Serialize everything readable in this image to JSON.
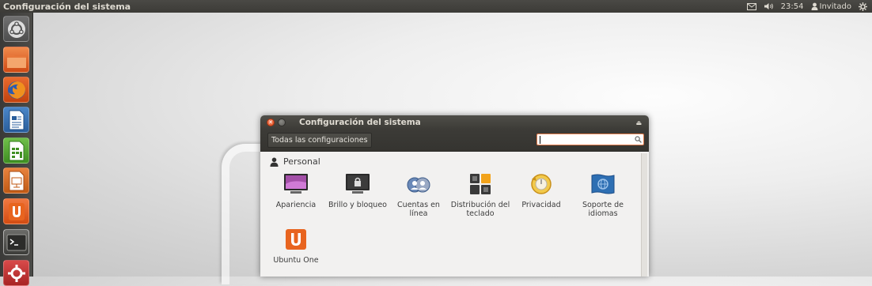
{
  "top_panel": {
    "title": "Configuración del sistema",
    "time": "23:54",
    "user": "Invitado",
    "icons": [
      "mail-icon",
      "volume-icon",
      "user-icon",
      "power-gear-icon"
    ]
  },
  "launcher": {
    "items": [
      {
        "name": "dash-home",
        "icon": "ubuntu-logo-icon"
      },
      {
        "name": "files",
        "icon": "folder-icon"
      },
      {
        "name": "firefox",
        "icon": "firefox-icon"
      },
      {
        "name": "writer",
        "icon": "libreoffice-writer-icon"
      },
      {
        "name": "calc",
        "icon": "libreoffice-calc-icon"
      },
      {
        "name": "impress",
        "icon": "libreoffice-impress-icon"
      },
      {
        "name": "ubuntu-one",
        "icon": "ubuntu-one-icon"
      },
      {
        "name": "terminal",
        "icon": "terminal-icon"
      },
      {
        "name": "system-settings",
        "icon": "settings-icon"
      }
    ]
  },
  "window": {
    "title": "Configuración del sistema",
    "all_settings_label": "Todas las configuraciones",
    "search": {
      "value": "",
      "placeholder": ""
    },
    "section_title": "Personal",
    "items": [
      {
        "label": "Apariencia",
        "icon": "appearance-icon"
      },
      {
        "label": "Brillo y bloqueo",
        "icon": "brightness-lock-icon"
      },
      {
        "label": "Cuentas en línea",
        "icon": "online-accounts-icon"
      },
      {
        "label": "Distribución del teclado",
        "icon": "keyboard-layout-icon"
      },
      {
        "label": "Privacidad",
        "icon": "privacy-icon"
      },
      {
        "label": "Soporte de idiomas",
        "icon": "language-support-icon"
      },
      {
        "label": "Ubuntu One",
        "icon": "ubuntu-one-icon"
      }
    ]
  },
  "colors": {
    "panel": "#3c3b37",
    "accent": "#dd4814",
    "window_bg": "#f2f1f0"
  }
}
